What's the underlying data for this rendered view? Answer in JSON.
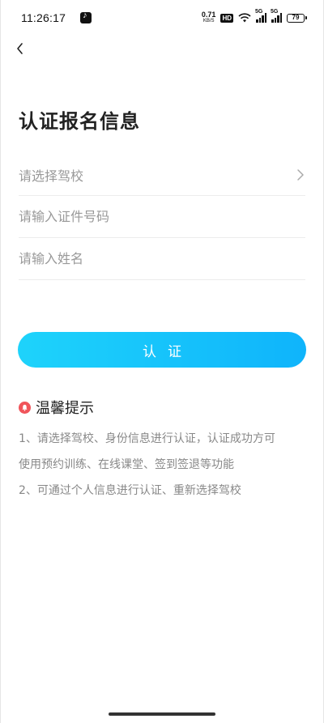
{
  "status_bar": {
    "time": "11:26:17",
    "net_speed_value": "0.71",
    "net_speed_unit": "KB/S",
    "hd_label": "HD",
    "sim1_label": "5G",
    "sim2_label": "5G",
    "battery_level": "79",
    "icons": [
      "tiktok-icon",
      "wifi-icon",
      "signal-icon",
      "battery-icon"
    ]
  },
  "header": {
    "back_icon": "chevron-left-icon",
    "title": "认证报名信息"
  },
  "form": {
    "school_placeholder": "请选择驾校",
    "id_placeholder": "请输入证件号码",
    "name_placeholder": "请输入姓名"
  },
  "submit_label": "认证",
  "tips": {
    "icon": "bell-icon",
    "title": "温馨提示",
    "lines": [
      "1、请选择驾校、身份信息进行认证，认证成功方可",
      "使用预约训练、在线课堂、签到签退等功能",
      "2、可通过个人信息进行认证、重新选择驾校"
    ]
  },
  "colors": {
    "button_gradient_start": "#1ed3fb",
    "button_gradient_end": "#0fb4fb",
    "bell_icon": "#f0545a",
    "placeholder": "#999999",
    "tips_text": "#888888"
  }
}
